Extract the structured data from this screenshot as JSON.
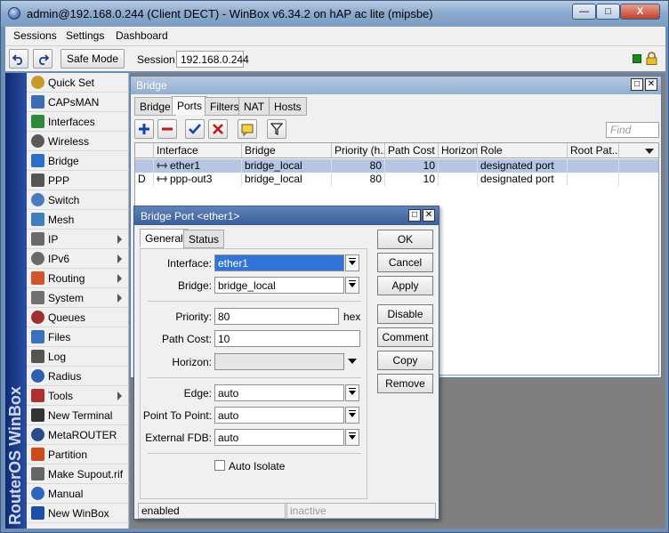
{
  "window": {
    "title": "admin@192.168.0.244 (Client DECT) - WinBox v6.34.2 on hAP ac lite (mipsbe)",
    "min_glyph": "—",
    "max_glyph": "□",
    "close_glyph": "X"
  },
  "menubar": {
    "items": [
      "Sessions",
      "Settings",
      "Dashboard"
    ]
  },
  "toolbar": {
    "safe_mode": "Safe Mode",
    "session_label": "Session:",
    "session_value": "192.168.0.244"
  },
  "brand": "RouterOS WinBox",
  "sidebar": {
    "items": [
      {
        "label": "Quick Set",
        "icon": "quick-set-icon",
        "submenu": false
      },
      {
        "label": "CAPsMAN",
        "icon": "capsman-icon",
        "submenu": false
      },
      {
        "label": "Interfaces",
        "icon": "interfaces-icon",
        "submenu": false
      },
      {
        "label": "Wireless",
        "icon": "wireless-icon",
        "submenu": false
      },
      {
        "label": "Bridge",
        "icon": "bridge-icon",
        "submenu": false
      },
      {
        "label": "PPP",
        "icon": "ppp-icon",
        "submenu": false
      },
      {
        "label": "Switch",
        "icon": "switch-icon",
        "submenu": false
      },
      {
        "label": "Mesh",
        "icon": "mesh-icon",
        "submenu": false
      },
      {
        "label": "IP",
        "icon": "ip-icon",
        "submenu": true
      },
      {
        "label": "IPv6",
        "icon": "ipv6-icon",
        "submenu": true
      },
      {
        "label": "Routing",
        "icon": "routing-icon",
        "submenu": true
      },
      {
        "label": "System",
        "icon": "system-icon",
        "submenu": true
      },
      {
        "label": "Queues",
        "icon": "queues-icon",
        "submenu": false
      },
      {
        "label": "Files",
        "icon": "files-icon",
        "submenu": false
      },
      {
        "label": "Log",
        "icon": "log-icon",
        "submenu": false
      },
      {
        "label": "Radius",
        "icon": "radius-icon",
        "submenu": false
      },
      {
        "label": "Tools",
        "icon": "tools-icon",
        "submenu": true
      },
      {
        "label": "New Terminal",
        "icon": "terminal-icon",
        "submenu": false
      },
      {
        "label": "MetaROUTER",
        "icon": "metarouter-icon",
        "submenu": false
      },
      {
        "label": "Partition",
        "icon": "partition-icon",
        "submenu": false
      },
      {
        "label": "Make Supout.rif",
        "icon": "supout-icon",
        "submenu": false
      },
      {
        "label": "Manual",
        "icon": "manual-icon",
        "submenu": false
      },
      {
        "label": "New WinBox",
        "icon": "winbox-icon",
        "submenu": false
      }
    ]
  },
  "bridge": {
    "title": "Bridge",
    "tabs": [
      "Bridge",
      "Ports",
      "Filters",
      "NAT",
      "Hosts"
    ],
    "active_tab": "Ports",
    "find_placeholder": "Find",
    "columns": [
      "",
      "Interface",
      "Bridge",
      "Priority (h...",
      "Path Cost",
      "Horizon",
      "Role",
      "Root Pat..."
    ],
    "rows": [
      {
        "flag": "",
        "interface": "ether1",
        "bridge": "bridge_local",
        "priority": "80",
        "path_cost": "10",
        "horizon": "",
        "role": "designated port",
        "root_path": "",
        "selected": true
      },
      {
        "flag": "D",
        "interface": "ppp-out3",
        "bridge": "bridge_local",
        "priority": "80",
        "path_cost": "10",
        "horizon": "",
        "role": "designated port",
        "root_path": "",
        "selected": false
      }
    ]
  },
  "dialog": {
    "title": "Bridge Port <ether1>",
    "tabs": [
      "General",
      "Status"
    ],
    "fields": {
      "interface": {
        "label": "Interface:",
        "value": "ether1"
      },
      "bridge": {
        "label": "Bridge:",
        "value": "bridge_local"
      },
      "priority": {
        "label": "Priority:",
        "value": "80",
        "suffix": "hex"
      },
      "path_cost": {
        "label": "Path Cost:",
        "value": "10"
      },
      "horizon": {
        "label": "Horizon:",
        "value": ""
      },
      "edge": {
        "label": "Edge:",
        "value": "auto"
      },
      "point_to_point": {
        "label": "Point To Point:",
        "value": "auto"
      },
      "external_fdb": {
        "label": "External FDB:",
        "value": "auto"
      },
      "auto_isolate": {
        "label": "Auto Isolate",
        "checked": false
      }
    },
    "buttons": [
      "OK",
      "Cancel",
      "Apply",
      "Disable",
      "Comment",
      "Copy",
      "Remove"
    ],
    "status_left": "enabled",
    "status_right": "inactive"
  },
  "colors": {
    "selection": "#b5c6e5",
    "titlebar": "#3b5f9c",
    "brand_band": "#1a3a8a"
  }
}
